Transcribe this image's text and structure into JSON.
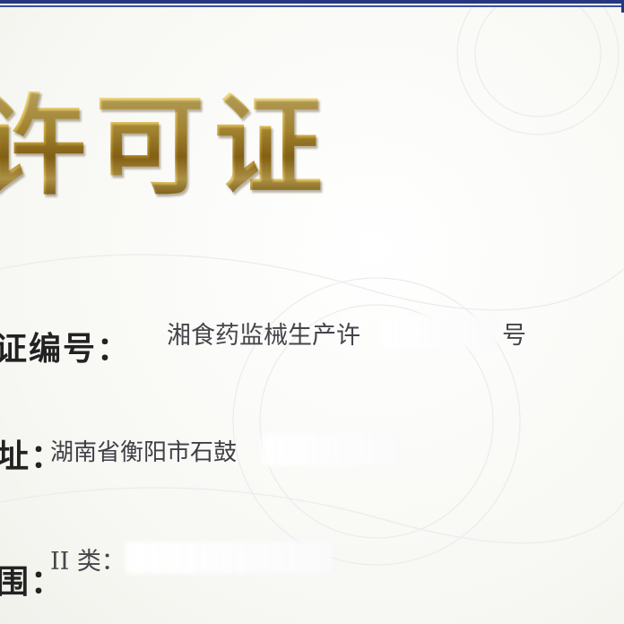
{
  "certificate": {
    "title": "许可证",
    "fields": [
      {
        "label": "证编号：",
        "value": "湘食药监械生产许",
        "suffix": "号"
      },
      {
        "label": "址：",
        "value": "湖南省衡阳市石鼓"
      },
      {
        "label": "围：",
        "value": "II 类："
      }
    ]
  },
  "colors": {
    "frame_blue": "#25387f",
    "title_gold": "#c9a53a",
    "paper": "#fbfbf8"
  }
}
